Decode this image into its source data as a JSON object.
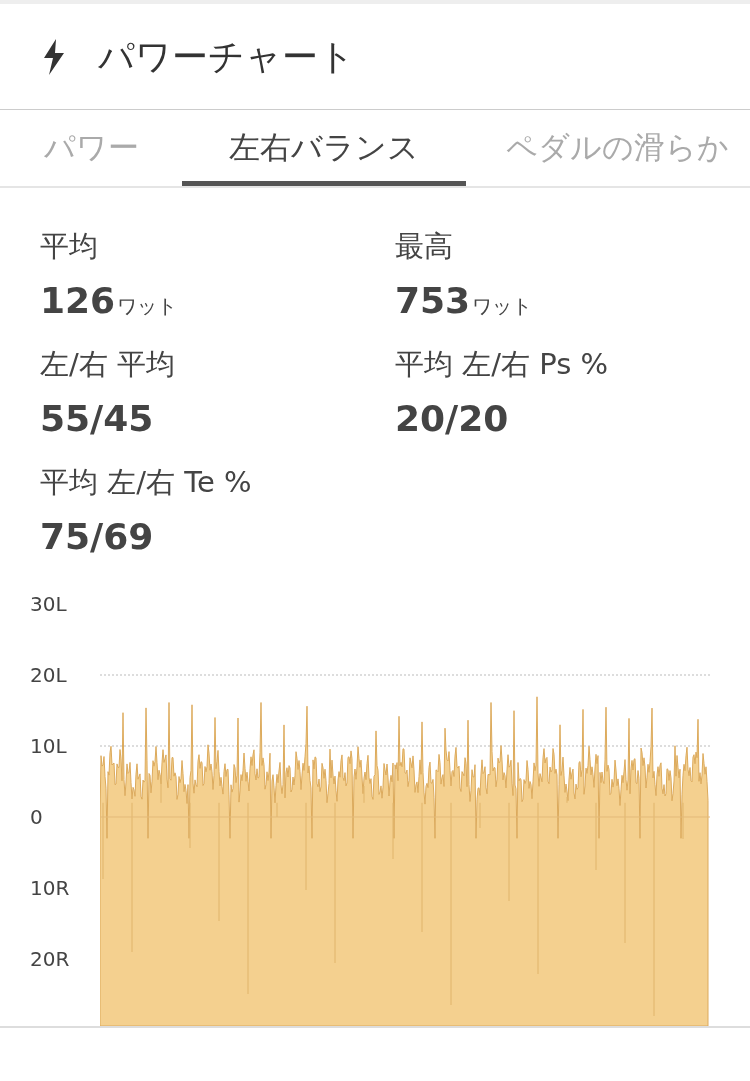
{
  "header": {
    "title": "パワーチャート"
  },
  "tabs": [
    {
      "label": "パワー",
      "selected": false
    },
    {
      "label": "左右バランス",
      "selected": true
    },
    {
      "label": "ペダルの滑らか",
      "selected": false
    }
  ],
  "stats": [
    {
      "label": "平均",
      "value": "126",
      "unit": "ワット"
    },
    {
      "label": "最高",
      "value": "753",
      "unit": "ワット"
    },
    {
      "label": "左/右 平均",
      "value": "55/45"
    },
    {
      "label": "平均 左/右 Ps %",
      "value": "20/20"
    },
    {
      "label": "平均 左/右 Te %",
      "value": "75/69"
    }
  ],
  "chart": {
    "y_labels": [
      "30L",
      "20L",
      "10L",
      "0",
      "10R",
      "20R"
    ]
  }
}
